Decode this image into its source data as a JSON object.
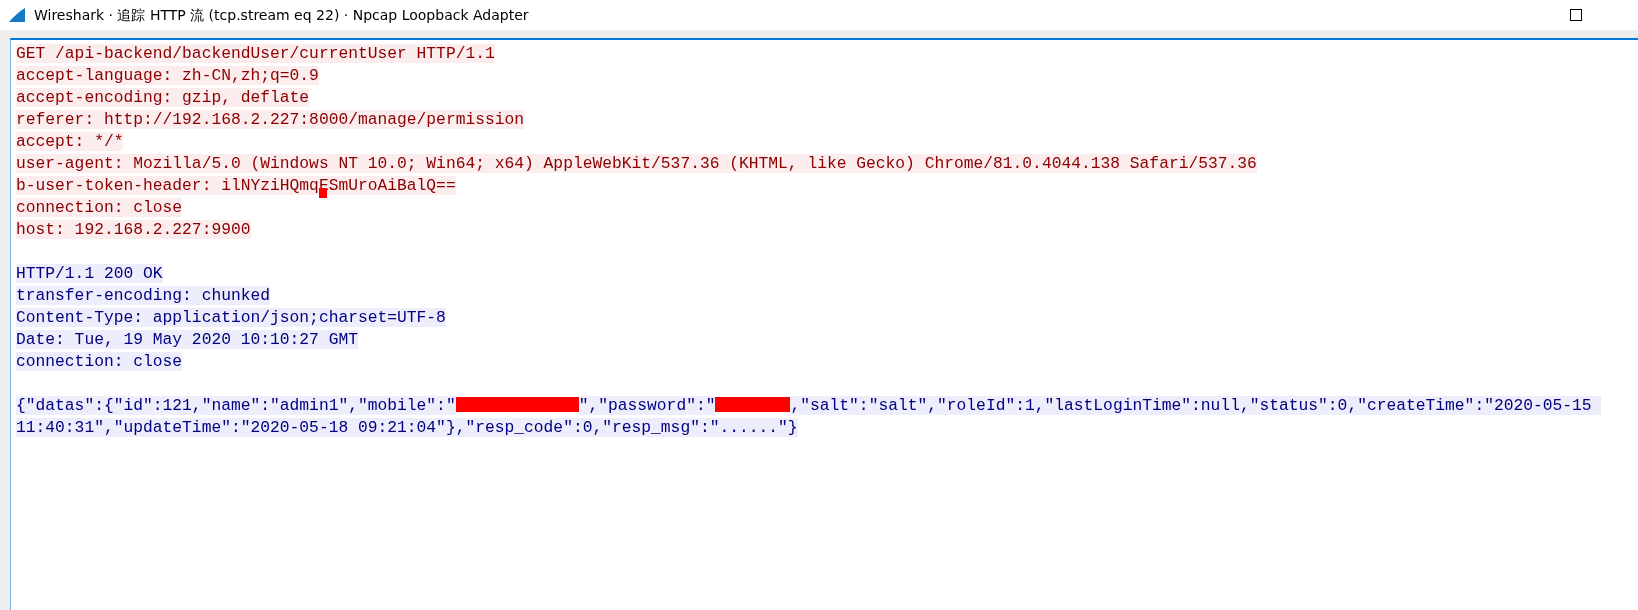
{
  "window": {
    "title": "Wireshark · 追踪 HTTP 流 (tcp.stream eq 22) · Npcap Loopback Adapter"
  },
  "request": {
    "lines": [
      {
        "text": "GET /api-backend/backendUser/currentUser HTTP/1.1",
        "redaction_mark": false
      },
      {
        "text": "accept-language: zh-CN,zh;q=0.9",
        "redaction_mark": false
      },
      {
        "text": "accept-encoding: gzip, deflate",
        "redaction_mark": false
      },
      {
        "text": "referer: http://192.168.2.227:8000/manage/permission",
        "redaction_mark": false
      },
      {
        "text": "accept: */*",
        "redaction_mark": false
      },
      {
        "text": "user-agent: Mozilla/5.0 (Windows NT 10.0; Win64; x64) AppleWebKit/537.36 (KHTML, like Gecko) Chrome/81.0.4044.138 Safari/537.36",
        "redaction_mark": false
      },
      {
        "text": "b-user-token-header: ilNYziHQmqESmUroAiBalQ==",
        "redaction_mark": true
      },
      {
        "text": "connection: close",
        "redaction_mark": false
      },
      {
        "text": "host: 192.168.2.227:9900",
        "redaction_mark": false
      }
    ]
  },
  "response": {
    "lines": [
      {
        "text": "HTTP/1.1 200 OK"
      },
      {
        "text": "transfer-encoding: chunked"
      },
      {
        "text": "Content-Type: application/json;charset=UTF-8"
      },
      {
        "text": "Date: Tue, 19 May 2020 10:10:27 GMT"
      },
      {
        "text": "connection: close"
      }
    ],
    "body": [
      {
        "kind": "text",
        "text": "{\"datas\":{\"id\":121,\"name\":\"admin1\",\"mobile\":\""
      },
      {
        "kind": "redaction"
      },
      {
        "kind": "text",
        "text": "\",\"password\":\""
      },
      {
        "kind": "blot"
      },
      {
        "kind": "text",
        "text": ",\"salt\":\"salt\",\"roleId\":1,\"lastLoginTime\":null,\"status\":0,\"createTime\":\"2020-05-15 11:40:31\",\"updateTime\":\"2020-05-18 09:21:04\"},\"resp_code\":0,\"resp_msg\":\"......\"}"
      }
    ]
  }
}
